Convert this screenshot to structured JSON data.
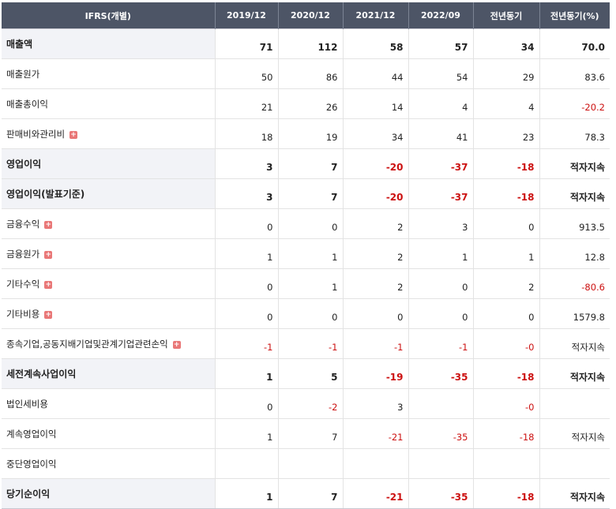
{
  "header": [
    "IFRS(개별)",
    "2019/12",
    "2020/12",
    "2021/12",
    "2022/09",
    "전년동기",
    "전년동기(%)"
  ],
  "rows": [
    {
      "label": "매출액",
      "bold": true,
      "expand": false,
      "values": [
        "71",
        "112",
        "58",
        "57",
        "34",
        "70.0"
      ]
    },
    {
      "label": "매출원가",
      "bold": false,
      "expand": false,
      "values": [
        "50",
        "86",
        "44",
        "54",
        "29",
        "83.6"
      ]
    },
    {
      "label": "매출총이익",
      "bold": false,
      "expand": false,
      "values": [
        "21",
        "26",
        "14",
        "4",
        "4",
        "-20.2"
      ]
    },
    {
      "label": "판매비와관리비",
      "bold": false,
      "expand": true,
      "values": [
        "18",
        "19",
        "34",
        "41",
        "23",
        "78.3"
      ]
    },
    {
      "label": "영업이익",
      "bold": true,
      "expand": false,
      "values": [
        "3",
        "7",
        "-20",
        "-37",
        "-18",
        "적자지속"
      ]
    },
    {
      "label": "영업이익(발표기준)",
      "bold": true,
      "expand": false,
      "values": [
        "3",
        "7",
        "-20",
        "-37",
        "-18",
        "적자지속"
      ]
    },
    {
      "label": "금융수익",
      "bold": false,
      "expand": true,
      "values": [
        "0",
        "0",
        "2",
        "3",
        "0",
        "913.5"
      ]
    },
    {
      "label": "금융원가",
      "bold": false,
      "expand": true,
      "values": [
        "1",
        "1",
        "2",
        "1",
        "1",
        "12.8"
      ]
    },
    {
      "label": "기타수익",
      "bold": false,
      "expand": true,
      "values": [
        "0",
        "1",
        "2",
        "0",
        "2",
        "-80.6"
      ]
    },
    {
      "label": "기타비용",
      "bold": false,
      "expand": true,
      "values": [
        "0",
        "0",
        "0",
        "0",
        "0",
        "1579.8"
      ]
    },
    {
      "label": "종속기업,공동지배기업및관계기업관련손익",
      "bold": false,
      "expand": true,
      "values": [
        "-1",
        "-1",
        "-1",
        "-1",
        "-0",
        "적자지속"
      ]
    },
    {
      "label": "세전계속사업이익",
      "bold": true,
      "expand": false,
      "values": [
        "1",
        "5",
        "-19",
        "-35",
        "-18",
        "적자지속"
      ]
    },
    {
      "label": "법인세비용",
      "bold": false,
      "expand": false,
      "values": [
        "0",
        "-2",
        "3",
        "",
        "-0",
        ""
      ]
    },
    {
      "label": "계속영업이익",
      "bold": false,
      "expand": false,
      "values": [
        "1",
        "7",
        "-21",
        "-35",
        "-18",
        "적자지속"
      ]
    },
    {
      "label": "중단영업이익",
      "bold": false,
      "expand": false,
      "values": [
        "",
        "",
        "",
        "",
        "",
        ""
      ]
    },
    {
      "label": "당기순이익",
      "bold": true,
      "expand": false,
      "values": [
        "1",
        "7",
        "-21",
        "-35",
        "-18",
        "적자지속"
      ]
    }
  ],
  "icons": {
    "expand": "plus-icon",
    "expand_color": "#e97777"
  },
  "colors": {
    "header_bg": "#4d5566",
    "negative": "#cc1111"
  }
}
